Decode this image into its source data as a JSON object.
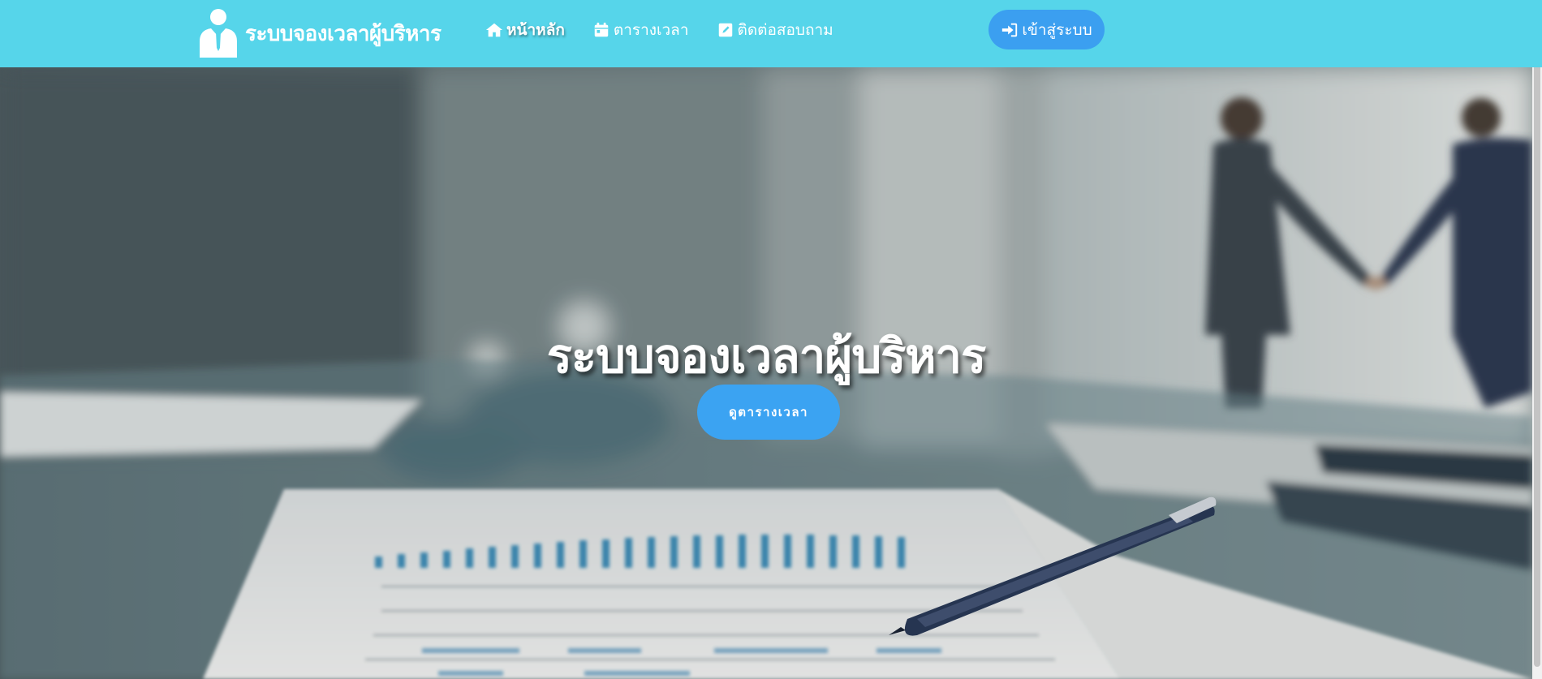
{
  "navbar": {
    "brand_text": "ระบบจองเวลาผู้บริหาร",
    "brand_icon": "executive-person-icon",
    "background_color": "#56d5ea",
    "items": [
      {
        "label": "หน้าหลัก",
        "icon": "home-icon",
        "active": true
      },
      {
        "label": "ตารางเวลา",
        "icon": "calendar-icon",
        "active": false
      },
      {
        "label": "ติดต่อสอบถาม",
        "icon": "edit-square-icon",
        "active": false
      }
    ],
    "login_button": {
      "label": "เข้าสู่ระบบ",
      "icon": "sign-in-icon",
      "color": "#3b9ff0"
    }
  },
  "hero": {
    "title": "ระบบจองเวลาผู้บริหาร",
    "button_label": "ดูตารางเวลา",
    "button_color": "#3ba3f2",
    "background_image": "blurred-office-desk-with-pen-documents-and-handshake"
  }
}
